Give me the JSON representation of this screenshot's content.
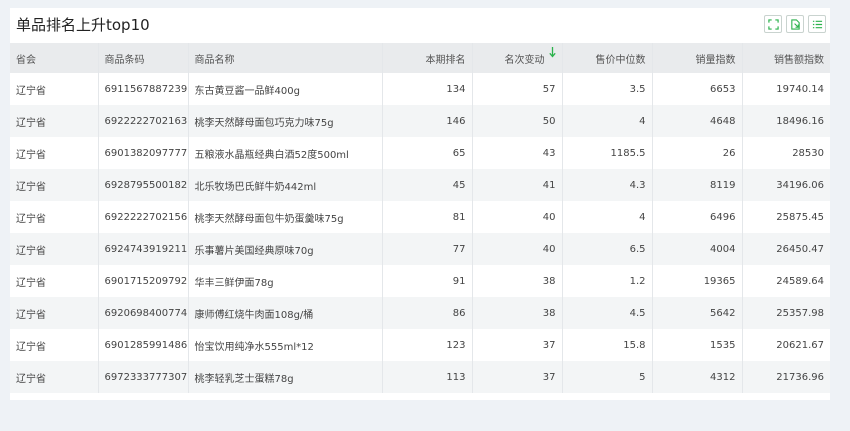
{
  "panel": {
    "title": "单品排名上升top10",
    "tools": {
      "fullscreen_icon": "fullscreen-icon",
      "export_icon": "export-icon",
      "list_icon": "list-icon"
    },
    "colors": {
      "accent": "#2bb24c",
      "header_bg": "#e9ebed",
      "row_alt_bg": "#f3f5f6",
      "page_bg": "#eef2f6"
    }
  },
  "table": {
    "headers": {
      "province": "省会",
      "barcode": "商品条码",
      "name": "商品名称",
      "rank": "本期排名",
      "change": "名次变动",
      "median_price": "售价中位数",
      "volume_index": "销量指数",
      "sales_index": "销售额指数"
    },
    "sort": {
      "column": "change",
      "direction": "descending",
      "icon": "sort-down-arrow-icon"
    },
    "rows": [
      {
        "province": "辽宁省",
        "barcode": "6911567887239",
        "name": "东古黄豆酱一品鲜400g",
        "rank": "134",
        "change": "57",
        "median_price": "3.5",
        "volume_index": "6653",
        "sales_index": "19740.14"
      },
      {
        "province": "辽宁省",
        "barcode": "6922222702163",
        "name": "桃李天然酵母面包巧克力味75g",
        "rank": "146",
        "change": "50",
        "median_price": "4",
        "volume_index": "4648",
        "sales_index": "18496.16"
      },
      {
        "province": "辽宁省",
        "barcode": "6901382097777",
        "name": "五粮液水晶瓶经典白酒52度500ml",
        "rank": "65",
        "change": "43",
        "median_price": "1185.5",
        "volume_index": "26",
        "sales_index": "28530"
      },
      {
        "province": "辽宁省",
        "barcode": "6928795500182",
        "name": "北乐牧场巴氏鲜牛奶442ml",
        "rank": "45",
        "change": "41",
        "median_price": "4.3",
        "volume_index": "8119",
        "sales_index": "34196.06"
      },
      {
        "province": "辽宁省",
        "barcode": "6922222702156",
        "name": "桃李天然酵母面包牛奶蛋羹味75g",
        "rank": "81",
        "change": "40",
        "median_price": "4",
        "volume_index": "6496",
        "sales_index": "25875.45"
      },
      {
        "province": "辽宁省",
        "barcode": "6924743919211",
        "name": "乐事薯片美国经典原味70g",
        "rank": "77",
        "change": "40",
        "median_price": "6.5",
        "volume_index": "4004",
        "sales_index": "26450.47"
      },
      {
        "province": "辽宁省",
        "barcode": "6901715209792",
        "name": "华丰三鲜伊面78g",
        "rank": "91",
        "change": "38",
        "median_price": "1.2",
        "volume_index": "19365",
        "sales_index": "24589.64"
      },
      {
        "province": "辽宁省",
        "barcode": "6920698400774",
        "name": "康师傅红烧牛肉面108g/桶",
        "rank": "86",
        "change": "38",
        "median_price": "4.5",
        "volume_index": "5642",
        "sales_index": "25357.98"
      },
      {
        "province": "辽宁省",
        "barcode": "6901285991486",
        "name": "怡宝饮用纯净水555ml*12",
        "rank": "123",
        "change": "37",
        "median_price": "15.8",
        "volume_index": "1535",
        "sales_index": "20621.67"
      },
      {
        "province": "辽宁省",
        "barcode": "6972333777307",
        "name": "桃李轻乳芝士蛋糕78g",
        "rank": "113",
        "change": "37",
        "median_price": "5",
        "volume_index": "4312",
        "sales_index": "21736.96"
      }
    ]
  }
}
